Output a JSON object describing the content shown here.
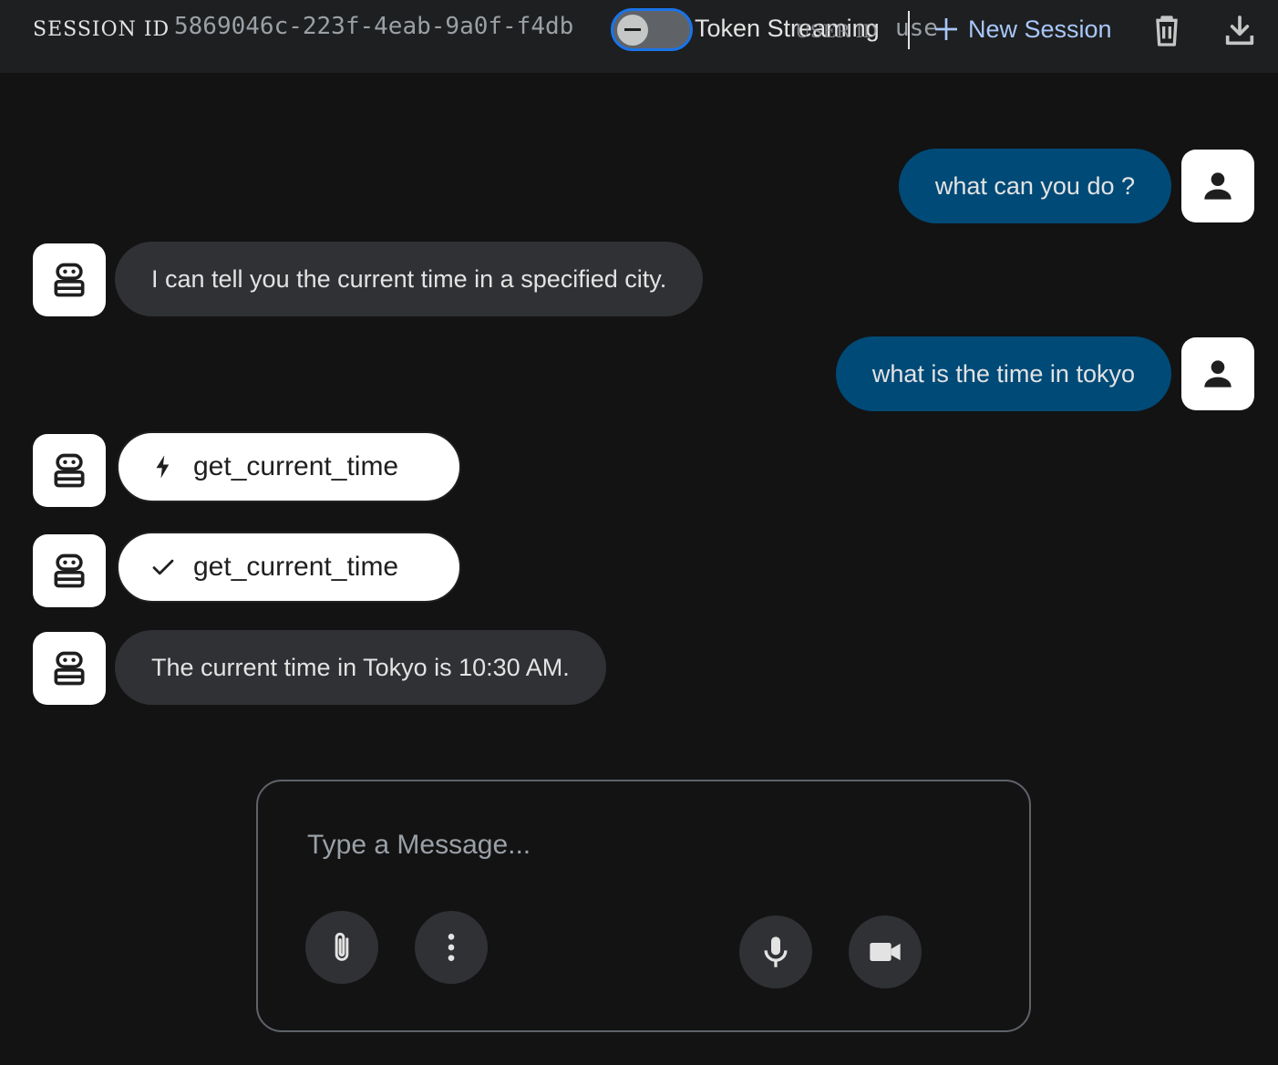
{
  "header": {
    "session_label": "SESSION ID",
    "session_id": "5869046c-223f-4eab-9a0f-f4db",
    "streaming_toggle_on": false,
    "streaming_label": "Token Streaming",
    "user_label": "USER ID",
    "user_value": "user",
    "new_session_label": "New Session",
    "icons": {
      "new_session": "add-icon",
      "delete": "trash-icon",
      "download": "download-icon"
    }
  },
  "chat": {
    "messages": [
      {
        "role": "user",
        "text": "what can you do ?"
      },
      {
        "role": "bot",
        "text": "I can tell you the current time in a specified city."
      },
      {
        "role": "user",
        "text": "what is the time in tokyo"
      },
      {
        "role": "bot-function-call",
        "text": "get_current_time",
        "icon": "bolt-icon"
      },
      {
        "role": "bot-function-response",
        "text": "get_current_time",
        "icon": "check-icon"
      },
      {
        "role": "bot",
        "text": "The current time in Tokyo is 10:30 AM."
      }
    ]
  },
  "composer": {
    "placeholder": "Type a Message...",
    "value": "",
    "buttons": [
      "attach-icon",
      "more-vert-icon",
      "mic-icon",
      "videocam-icon"
    ]
  },
  "colors": {
    "background": "#131314",
    "topbar": "#1e1f20",
    "user_bubble": "#004a77",
    "bot_bubble": "#303134",
    "accent": "#1a73e8",
    "link": "#a8c7fa"
  }
}
